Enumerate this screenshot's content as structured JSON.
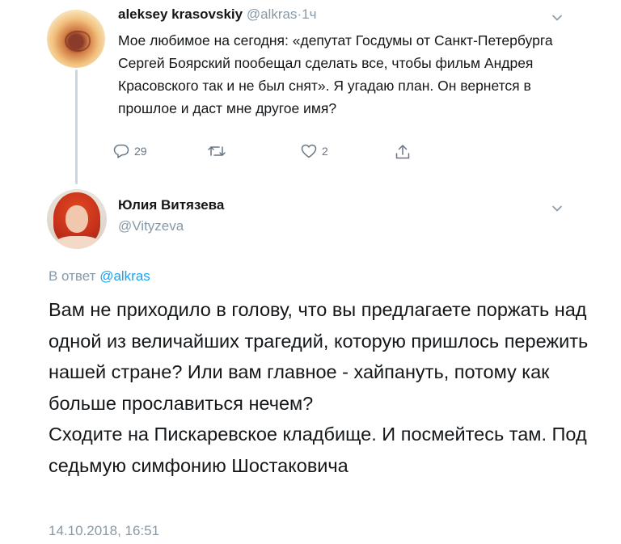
{
  "parent_tweet": {
    "author_name": "aleksey krasovskiy",
    "handle": "@alkras",
    "separator": "·",
    "time": "1ч",
    "text": "Мое любимое на сегодня: «депутат Госдумы от Санкт-Петербурга Сергей Боярский пообещал сделать все, чтобы фильм Андрея Красовского так и не был снят». Я угадаю план. Он вернется в прошлое и даст мне другое имя?",
    "actions": {
      "reply_count": "29",
      "retweet_count": "",
      "like_count": "2"
    }
  },
  "reply_tweet": {
    "author_name": "Юлия Витязева",
    "handle": "@Vityzeva",
    "reply_prefix": "В ответ",
    "reply_to_handle": "@alkras",
    "text_paragraphs": [
      "Вам не приходило в голову, что вы предлагаете поржать над одной из величайших трагедий, которую пришлось пережить нашей стране? Или вам главное - хайпануть, потому как больше прославиться нечем?",
      "Сходите на Пискаревское кладбище. И посмейтесь там. Под седьмую симфонию Шостаковича"
    ],
    "timestamp": "14.10.2018, 16:51"
  },
  "icons": {
    "reply": "reply-icon",
    "retweet": "retweet-icon",
    "like": "heart-icon",
    "share": "share-icon",
    "menu": "chevron-down-icon"
  },
  "colors": {
    "text": "#14171a",
    "secondary": "#8899a6",
    "link": "#1da1f2",
    "thread_line": "#ccd6dd"
  }
}
